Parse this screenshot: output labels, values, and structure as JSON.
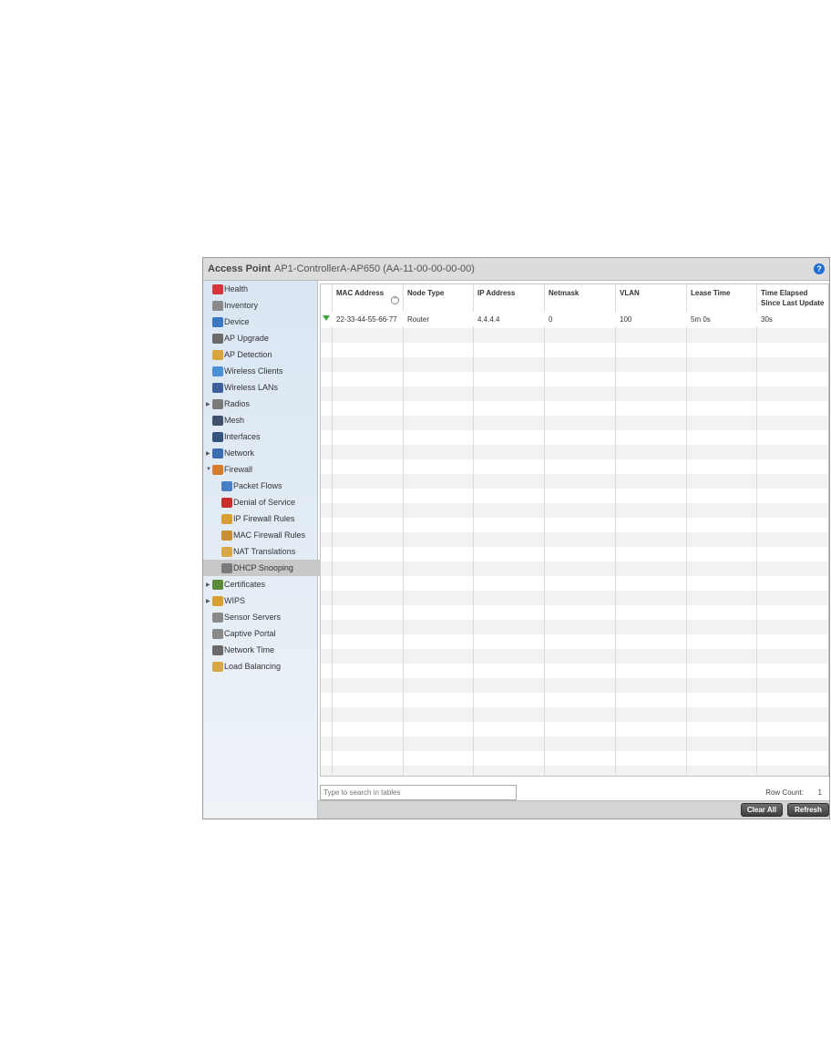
{
  "header": {
    "title": "Access Point",
    "device": "AP1-ControllerA-AP650 (AA-11-00-00-00-00)",
    "help": "?"
  },
  "sidebar": {
    "items": [
      {
        "label": "Health",
        "icon": "health-icon",
        "color": "#d8343c"
      },
      {
        "label": "Inventory",
        "icon": "inventory-icon",
        "color": "#8a8a8a"
      },
      {
        "label": "Device",
        "icon": "device-icon",
        "color": "#3a78c2"
      },
      {
        "label": "AP Upgrade",
        "icon": "ap-upgrade-icon",
        "color": "#6a6a6a"
      },
      {
        "label": "AP Detection",
        "icon": "ap-detection-icon",
        "color": "#d9a53a"
      },
      {
        "label": "Wireless Clients",
        "icon": "wireless-clients-icon",
        "color": "#4b8fd6"
      },
      {
        "label": "Wireless LANs",
        "icon": "wireless-lans-icon",
        "color": "#3f5f9a"
      },
      {
        "label": "Radios",
        "icon": "radios-icon",
        "color": "#7a7a7a"
      },
      {
        "label": "Mesh",
        "icon": "mesh-icon",
        "color": "#3f4f6a"
      },
      {
        "label": "Interfaces",
        "icon": "interfaces-icon",
        "color": "#34547f"
      },
      {
        "label": "Network",
        "icon": "network-icon",
        "color": "#3b6db0"
      },
      {
        "label": "Firewall",
        "icon": "firewall-icon",
        "color": "#d87b2a"
      },
      {
        "label": "Packet Flows",
        "icon": "packet-flows-icon",
        "color": "#4a7ec4"
      },
      {
        "label": "Denial of Service",
        "icon": "denial-of-service-icon",
        "color": "#c83030"
      },
      {
        "label": "IP Firewall Rules",
        "icon": "ip-firewall-rules-icon",
        "color": "#d8a030"
      },
      {
        "label": "MAC Firewall Rules",
        "icon": "mac-firewall-rules-icon",
        "color": "#c89030"
      },
      {
        "label": "NAT Translations",
        "icon": "nat-translations-icon",
        "color": "#d8a845"
      },
      {
        "label": "DHCP Snooping",
        "icon": "dhcp-snooping-icon",
        "color": "#7a7a7a"
      },
      {
        "label": "Certificates",
        "icon": "certificates-icon",
        "color": "#5a8a3a"
      },
      {
        "label": "WIPS",
        "icon": "wips-icon",
        "color": "#d8a030"
      },
      {
        "label": "Sensor Servers",
        "icon": "sensor-servers-icon",
        "color": "#8a8a8a"
      },
      {
        "label": "Captive Portal",
        "icon": "captive-portal-icon",
        "color": "#8a8a8a"
      },
      {
        "label": "Network Time",
        "icon": "network-time-icon",
        "color": "#6a6a6a"
      },
      {
        "label": "Load Balancing",
        "icon": "load-balancing-icon",
        "color": "#d8a845"
      }
    ]
  },
  "table": {
    "columns": [
      "MAC Address",
      "Node Type",
      "IP Address",
      "Netmask",
      "VLAN",
      "Lease Time",
      "Time Elapsed\nSince Last Update"
    ],
    "rows": [
      {
        "status_icon": "green-down-arrow-icon",
        "cells": [
          "22-33-44-55-66-77",
          "Router",
          "4.4.4.4",
          "0",
          "100",
          "5m 0s",
          "30s"
        ]
      }
    ]
  },
  "search": {
    "placeholder": "Type to search in tables"
  },
  "rowcount": {
    "label": "Row Count:",
    "value": "1"
  },
  "buttons": {
    "clear_all": "Clear All",
    "refresh": "Refresh"
  },
  "colors": {
    "selected_row": "#c8c8c8",
    "status_green": "#3aa53a",
    "help_blue": "#1f6ed4"
  }
}
